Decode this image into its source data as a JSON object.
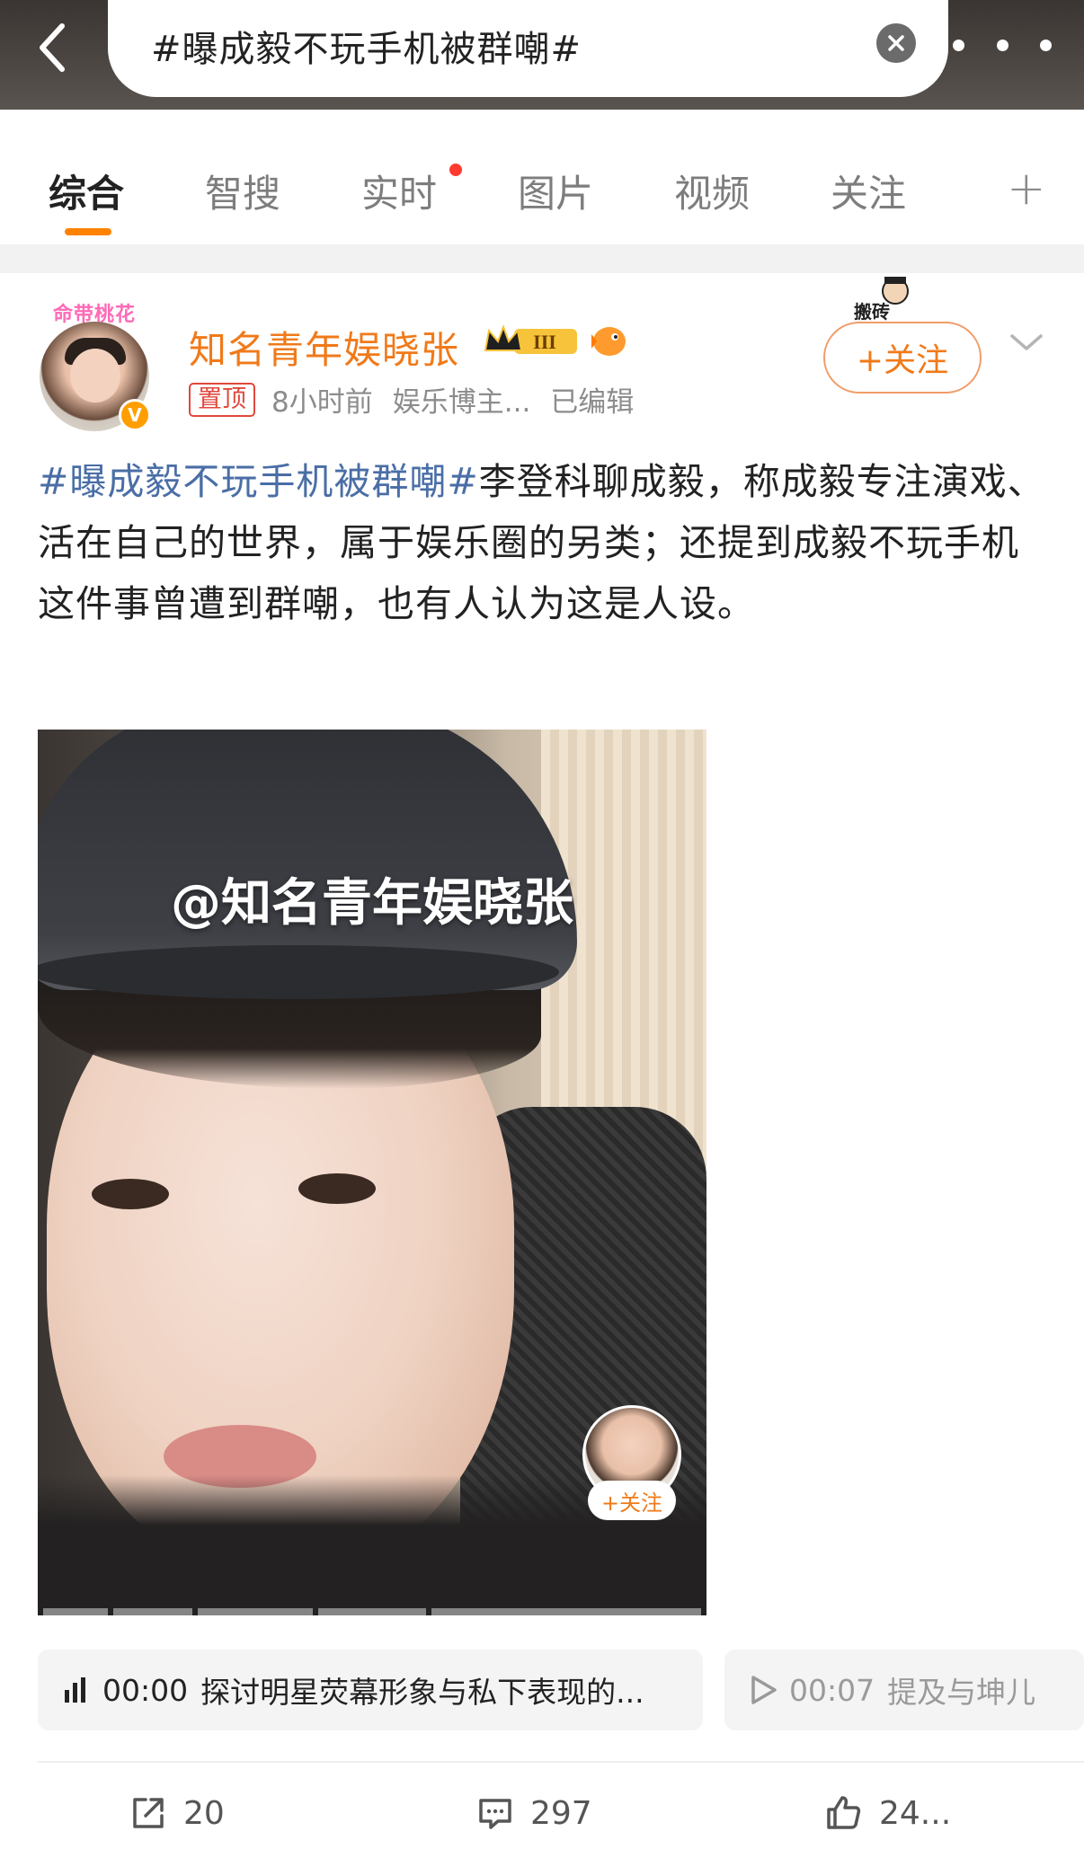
{
  "search": {
    "query": "#曝成毅不玩手机被群嘲#"
  },
  "tabs": [
    {
      "label": "综合",
      "active": true
    },
    {
      "label": "智搜"
    },
    {
      "label": "实时",
      "has_dot": true
    },
    {
      "label": "图片"
    },
    {
      "label": "视频"
    },
    {
      "label": "关注"
    }
  ],
  "post": {
    "avatar_deco": "命带桃花",
    "user_name": "知名青年娱晓张",
    "level_badge": "III",
    "pinned_label": "置顶",
    "time": "8小时前",
    "category": "娱乐博主...",
    "edited": "已编辑",
    "follow_label": "+关注",
    "follow_sticker": "搬砖",
    "hashtag": "#曝成毅不玩手机被群嘲#",
    "text": "李登科聊成毅，称成毅专注演戏、活在自己的世界，属于娱乐圈的另类；还提到成毅不玩手机这件事曾遭到群嘲，也有人认为这是人设。",
    "video": {
      "watermark": "@知名青年娱晓张",
      "mini_follow_label": "+关注"
    },
    "chapters": [
      {
        "time": "00:00",
        "title": "探讨明星荧幕形象与私下表现的..."
      },
      {
        "time": "00:07",
        "title": "提及与坤儿"
      }
    ],
    "actions": {
      "shares": "20",
      "comments": "297",
      "likes": "24..."
    }
  },
  "colors": {
    "accent": "#ff8200",
    "username": "#f07a1a",
    "hashtag": "#4a6ea6",
    "pin": "#e0483c"
  }
}
